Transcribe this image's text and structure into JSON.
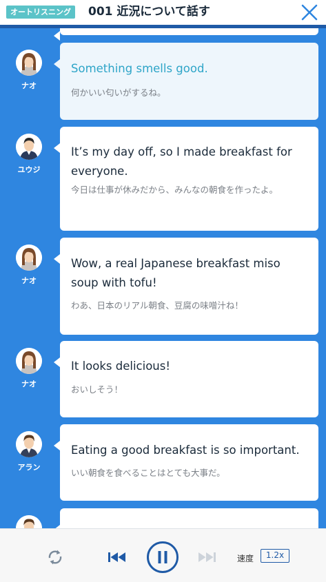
{
  "header": {
    "mode_badge": "オートリスニング",
    "lesson_title": "001  近況について話す",
    "close_icon": "close-icon"
  },
  "dialogue": [
    {
      "speaker": "ナオ",
      "avatar": "avatar-female-nao",
      "en": "Something smells good.",
      "ja": "何かいい匂いがするね。",
      "active": true
    },
    {
      "speaker": "ユウジ",
      "avatar": "avatar-male-yuji",
      "en": "It’s my day off, so I made breakfast for everyone.",
      "ja": "今日は仕事が休みだから、みんなの朝食を作ったよ。",
      "active": false
    },
    {
      "speaker": "ナオ",
      "avatar": "avatar-female-nao",
      "en": "Wow, a real Japanese breakfast miso soup with tofu!",
      "ja": "わあ、日本のリアル朝食、豆腐の味噌汁ね！",
      "active": false
    },
    {
      "speaker": "ナオ",
      "avatar": "avatar-female-nao",
      "en": "It looks delicious!",
      "ja": "おいしそう！",
      "active": false
    },
    {
      "speaker": "アラン",
      "avatar": "avatar-male-alan",
      "en": "Eating a good breakfast is so important.",
      "ja": "いい朝食を食べることはとても大事だ。",
      "active": false
    }
  ],
  "player": {
    "repeat_icon": "repeat-icon",
    "prev_icon": "skip-previous-icon",
    "pause_icon": "pause-icon",
    "next_icon": "skip-next-icon",
    "speed_label": "速度",
    "speed_value": "1.2x"
  },
  "colors": {
    "chat_background": "#2f86e0",
    "accent_blue": "#1f5aa6",
    "badge_teal": "#5bc3c8",
    "highlight_text": "#2ea5c8"
  }
}
